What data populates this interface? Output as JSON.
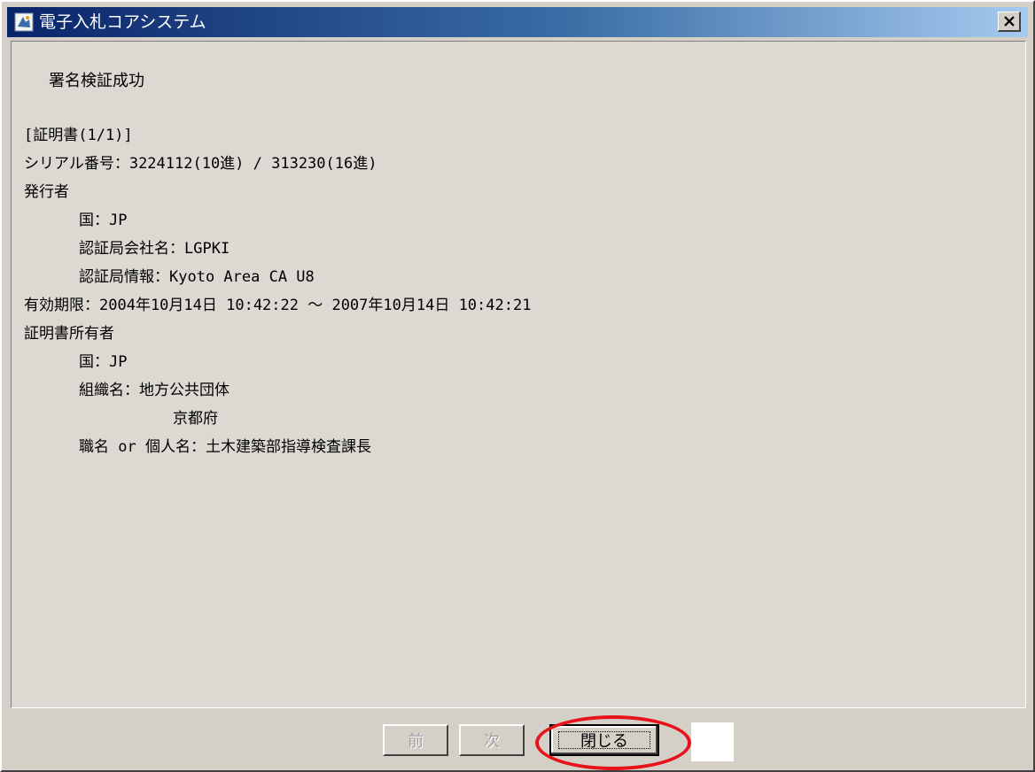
{
  "window": {
    "title": "電子入札コアシステム",
    "close_glyph": "×"
  },
  "content": {
    "status": "署名検証成功",
    "certificate_lines": [
      "[証明書(1/1)]",
      "シリアル番号：3224112(10進) / 313230(16進)",
      "発行者",
      "国：JP",
      "認証局会社名：LGPKI",
      "認証局情報：Kyoto Area CA U8",
      "有効期限：2004年10月14日 10:42:22 ～ 2007年10月14日 10:42:21",
      "証明書所有者",
      "国：JP",
      "組織名：地方公共団体",
      "京都府",
      "職名 or 個人名：土木建築部指導検査課長"
    ]
  },
  "buttons": {
    "prev_label": "前",
    "next_label": "次",
    "close_label": "閉じる"
  },
  "colors": {
    "titlebar_start": "#0a246a",
    "titlebar_end": "#a6caf0",
    "panel_bg": "#dcd8d2",
    "window_bg": "#d4d0c8",
    "highlight": "#e8131a"
  },
  "icons": {
    "app": "app-icon",
    "close": "close-icon"
  }
}
